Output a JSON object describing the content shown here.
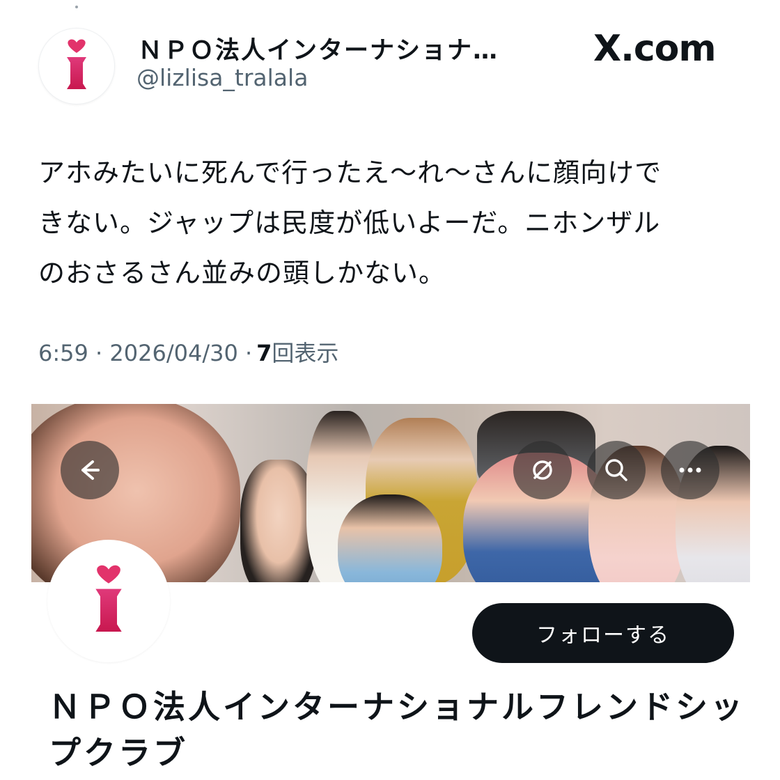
{
  "tweet": {
    "display_name": "ＮＰＯ法人インターナショナ…",
    "handle": "@lizlisa_tralala",
    "brand": "X.com",
    "text": "アホみたいに死んで行ったえ〜れ〜さんに顔向けで\nきない。ジャップは民度が低いよーだ。ニホンザル\nのおさるさん並みの頭しかない。",
    "time": "6:59 · 2026/04/30 · ",
    "views_count": "7",
    "views_label": "回表示"
  },
  "banner": {
    "buttons": [
      {
        "name": "back",
        "icon": "arrow-left-icon"
      },
      {
        "name": "share",
        "icon": "rotate-icon"
      },
      {
        "name": "search",
        "icon": "search-icon"
      },
      {
        "name": "more",
        "icon": "more-icon"
      }
    ]
  },
  "profile": {
    "follow_label": "フォローする",
    "name": "ＮＰＯ法人インターナショナルフレンドシップクラブ"
  },
  "colors": {
    "text": "#0f1419",
    "secondary": "#536471",
    "logo_pink": "#e2336b",
    "button_bg": "#0f1419"
  }
}
